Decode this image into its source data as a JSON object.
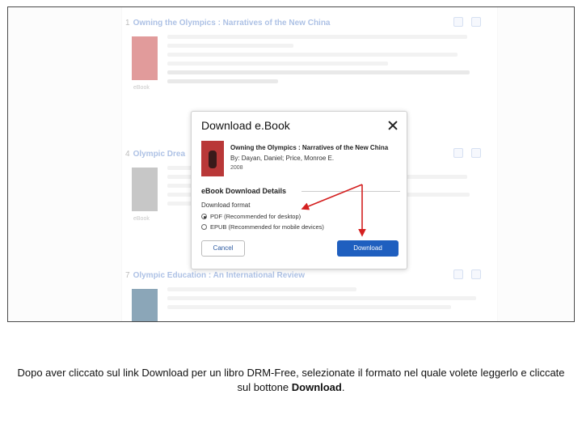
{
  "results": [
    {
      "number": "1",
      "title": "Owning the Olympics : Narratives of the New China",
      "cover_label": "eBook"
    },
    {
      "number": "4",
      "title": "Olympic Drea",
      "cover_label": "eBook"
    },
    {
      "number": "7",
      "title": "Olympic Education : An International Review",
      "cover_label": ""
    }
  ],
  "modal": {
    "title": "Download e.Book",
    "book_title": "Owning the Olympics : Narratives of the New China",
    "book_by": "By: Dayan, Daniel; Price, Monroe E.",
    "book_year": "2008",
    "section_title": "eBook Download Details",
    "format_label": "Download format",
    "options": [
      {
        "label": "PDF (Recommended for desktop)",
        "selected": true
      },
      {
        "label": "EPUB (Recommended for mobile devices)",
        "selected": false
      }
    ],
    "cancel_label": "Cancel",
    "download_label": "Download"
  },
  "caption": {
    "text": "Dopo aver cliccato sul link Download per un libro DRM-Free, selezionate il formato nel quale volete leggerlo e cliccate sul bottone",
    "bold": "Download",
    "end": "."
  },
  "colors": {
    "arrow": "#d42020",
    "download_button": "#1f5fbf",
    "link": "#4f78c2"
  }
}
